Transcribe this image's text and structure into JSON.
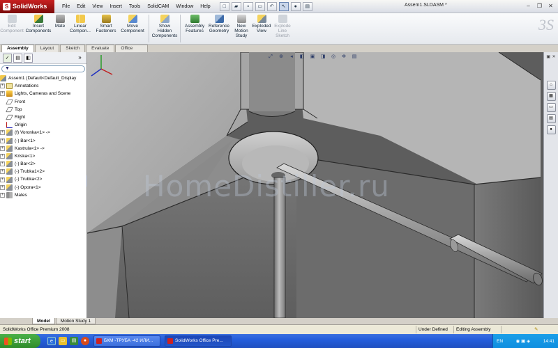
{
  "app": {
    "logo_text": "SolidWorks",
    "document_title": "Assem1.SLDASM *",
    "menu": [
      "File",
      "Edit",
      "View",
      "Insert",
      "Tools",
      "SolidCAM",
      "Window",
      "Help"
    ]
  },
  "command_manager": {
    "commands": [
      {
        "label": "Edit Component",
        "icon": "edit-component-icon",
        "enabled": false
      },
      {
        "label": "Insert Components",
        "icon": "insert-components-icon",
        "enabled": true
      },
      {
        "label": "Mate",
        "icon": "mate-icon",
        "enabled": true
      },
      {
        "label": "Linear Compon...",
        "icon": "linear-pattern-icon",
        "enabled": true
      },
      {
        "label": "Smart Fasteners",
        "icon": "smart-fasteners-icon",
        "enabled": true
      },
      {
        "label": "Move Component",
        "icon": "move-component-icon",
        "enabled": true
      },
      {
        "label": "Show Hidden Components",
        "icon": "show-hidden-icon",
        "enabled": true
      },
      {
        "label": "Assembly Features",
        "icon": "assembly-features-icon",
        "enabled": true
      },
      {
        "label": "Reference Geometry",
        "icon": "reference-geometry-icon",
        "enabled": true
      },
      {
        "label": "New Motion Study",
        "icon": "motion-study-icon",
        "enabled": true
      },
      {
        "label": "Exploded View",
        "icon": "exploded-view-icon",
        "enabled": true
      },
      {
        "label": "Explode Line Sketch",
        "icon": "explode-line-icon",
        "enabled": false
      }
    ],
    "tabs": [
      "Assembly",
      "Layout",
      "Sketch",
      "Evaluate",
      "Office Products"
    ],
    "active_tab": "Assembly"
  },
  "feature_tree": {
    "root": "Assem1  (Default<Default_Display",
    "items": [
      {
        "label": "Annotations",
        "icon": "annotations-icon",
        "expandable": true
      },
      {
        "label": "Lights, Cameras and Scene",
        "icon": "lights-icon",
        "expandable": true
      },
      {
        "label": "Front",
        "icon": "plane-icon",
        "expandable": false
      },
      {
        "label": "Top",
        "icon": "plane-icon",
        "expandable": false
      },
      {
        "label": "Right",
        "icon": "plane-icon",
        "expandable": false
      },
      {
        "label": "Origin",
        "icon": "origin-icon",
        "expandable": false
      },
      {
        "label": "(f) Voronka<1> ->",
        "icon": "part-icon",
        "expandable": true
      },
      {
        "label": "(-) Bar<1>",
        "icon": "part-icon",
        "expandable": true
      },
      {
        "label": "Kastrula<1> ->",
        "icon": "part-icon",
        "expandable": true
      },
      {
        "label": "Kriska<1>",
        "icon": "part-icon",
        "expandable": true
      },
      {
        "label": "(-) Bar<2>",
        "icon": "part-icon",
        "expandable": true
      },
      {
        "label": "(-) Trubka1<2>",
        "icon": "part-icon",
        "expandable": true
      },
      {
        "label": "(-) Trubka<2>",
        "icon": "part-icon",
        "expandable": true
      },
      {
        "label": "(-) Opora<1>",
        "icon": "part-icon",
        "expandable": true
      },
      {
        "label": "Mates",
        "icon": "mates-icon",
        "expandable": true
      }
    ]
  },
  "viewport": {
    "watermark": "HomeDistiller.ru"
  },
  "bottom_tabs": [
    "Model",
    "Motion Study 1"
  ],
  "status": {
    "product": "SolidWorks Office Premium 2008",
    "definition": "Under Defined",
    "mode": "Editing Assembly"
  },
  "taskbar": {
    "start_label": "start",
    "buttons": [
      {
        "label": "БКМ -ТРУБА -42 ИЛИ...",
        "active": false
      },
      {
        "label": "SolidWorks Office Pre...",
        "active": true
      }
    ],
    "language": "EN",
    "clock": "14:41"
  }
}
